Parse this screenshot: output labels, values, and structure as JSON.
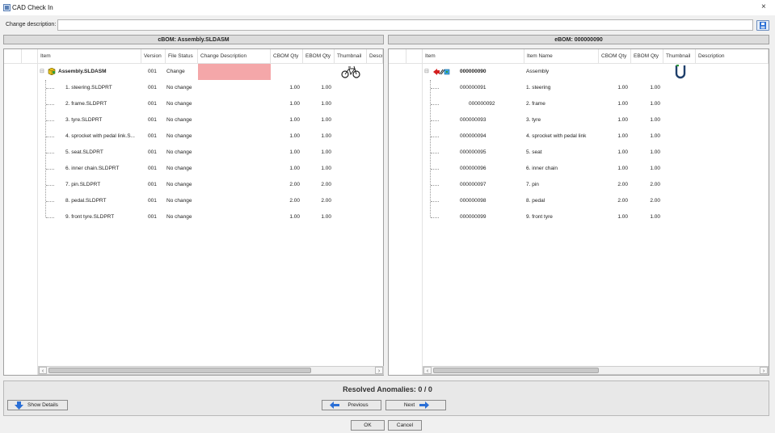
{
  "window": {
    "title": "CAD Check In",
    "close": "×"
  },
  "change_description": {
    "label": "Change description:",
    "value": ""
  },
  "cbom": {
    "title": "cBOM: Assembly.SLDASM",
    "columns": [
      "Item",
      "Version",
      "File Status",
      "Change Description",
      "CBOM Qty",
      "EBOM Qty",
      "Thumbnail",
      "Descr"
    ],
    "root": {
      "item": "Assembly.SLDASM",
      "version": "001",
      "status": "Change",
      "change_desc": "",
      "cbom_qty": "",
      "ebom_qty": "",
      "thumbnail": "bicycle-thumbnail"
    },
    "rows": [
      {
        "item": "1. steering.SLDPRT",
        "version": "001",
        "status": "No change",
        "cbom_qty": "1.00",
        "ebom_qty": "1.00",
        "thumbnail": "steering-thumbnail"
      },
      {
        "item": "2. frame.SLDPRT",
        "version": "001",
        "status": "No change",
        "cbom_qty": "1.00",
        "ebom_qty": "1.00",
        "thumbnail": "frame-thumbnail"
      },
      {
        "item": "3. tyre.SLDPRT",
        "version": "001",
        "status": "No change",
        "cbom_qty": "1.00",
        "ebom_qty": "1.00",
        "thumbnail": "tyre-thumbnail"
      },
      {
        "item": "4. sprocket with pedal link.S...",
        "version": "001",
        "status": "No change",
        "cbom_qty": "1.00",
        "ebom_qty": "1.00",
        "thumbnail": "sprocket-thumbnail"
      },
      {
        "item": "5. seat.SLDPRT",
        "version": "001",
        "status": "No change",
        "cbom_qty": "1.00",
        "ebom_qty": "1.00",
        "thumbnail": "seat-thumbnail"
      },
      {
        "item": "6. inner chain.SLDPRT",
        "version": "001",
        "status": "No change",
        "cbom_qty": "1.00",
        "ebom_qty": "1.00",
        "thumbnail": "chain-thumbnail"
      },
      {
        "item": "7. pin.SLDPRT",
        "version": "001",
        "status": "No change",
        "cbom_qty": "2.00",
        "ebom_qty": "2.00",
        "thumbnail": "pin-thumbnail"
      },
      {
        "item": "8. pedal.SLDPRT",
        "version": "001",
        "status": "No change",
        "cbom_qty": "2.00",
        "ebom_qty": "2.00",
        "thumbnail": "pedal-thumbnail"
      },
      {
        "item": "9. front tyre.SLDPRT",
        "version": "001",
        "status": "No change",
        "cbom_qty": "1.00",
        "ebom_qty": "1.00",
        "thumbnail": "tyre-thumbnail"
      }
    ]
  },
  "ebom": {
    "title": "eBOM: 000000090",
    "columns": [
      "Item",
      "Item Name",
      "CBOM Qty",
      "EBOM Qty",
      "Thumbnail",
      "Description"
    ],
    "root": {
      "item": "000000090",
      "name": "Assembly",
      "cbom_qty": "",
      "ebom_qty": ""
    },
    "rows": [
      {
        "item": "000000091",
        "name": "1. steering",
        "cbom_qty": "1.00",
        "ebom_qty": "1.00"
      },
      {
        "item": "000000092",
        "name": "2. frame",
        "cbom_qty": "1.00",
        "ebom_qty": "1.00"
      },
      {
        "item": "000000093",
        "name": "3. tyre",
        "cbom_qty": "1.00",
        "ebom_qty": "1.00"
      },
      {
        "item": "000000094",
        "name": "4. sprocket with pedal link",
        "cbom_qty": "1.00",
        "ebom_qty": "1.00"
      },
      {
        "item": "000000095",
        "name": "5. seat",
        "cbom_qty": "1.00",
        "ebom_qty": "1.00"
      },
      {
        "item": "000000096",
        "name": "6. inner chain",
        "cbom_qty": "1.00",
        "ebom_qty": "1.00"
      },
      {
        "item": "000000097",
        "name": "7. pin",
        "cbom_qty": "2.00",
        "ebom_qty": "2.00"
      },
      {
        "item": "000000098",
        "name": "8. pedal",
        "cbom_qty": "2.00",
        "ebom_qty": "2.00"
      },
      {
        "item": "000000099",
        "name": "9. front tyre",
        "cbom_qty": "1.00",
        "ebom_qty": "1.00"
      }
    ]
  },
  "anomalies": {
    "text": "Resolved Anomalies: 0 / 0"
  },
  "buttons": {
    "show_details": "Show Details",
    "previous": "Previous",
    "next": "Next",
    "ok": "OK",
    "cancel": "Cancel"
  },
  "colors": {
    "change_highlight": "#f4a7a9",
    "accent": "#2a6fd6",
    "part_yellow": "#e8c21a"
  }
}
